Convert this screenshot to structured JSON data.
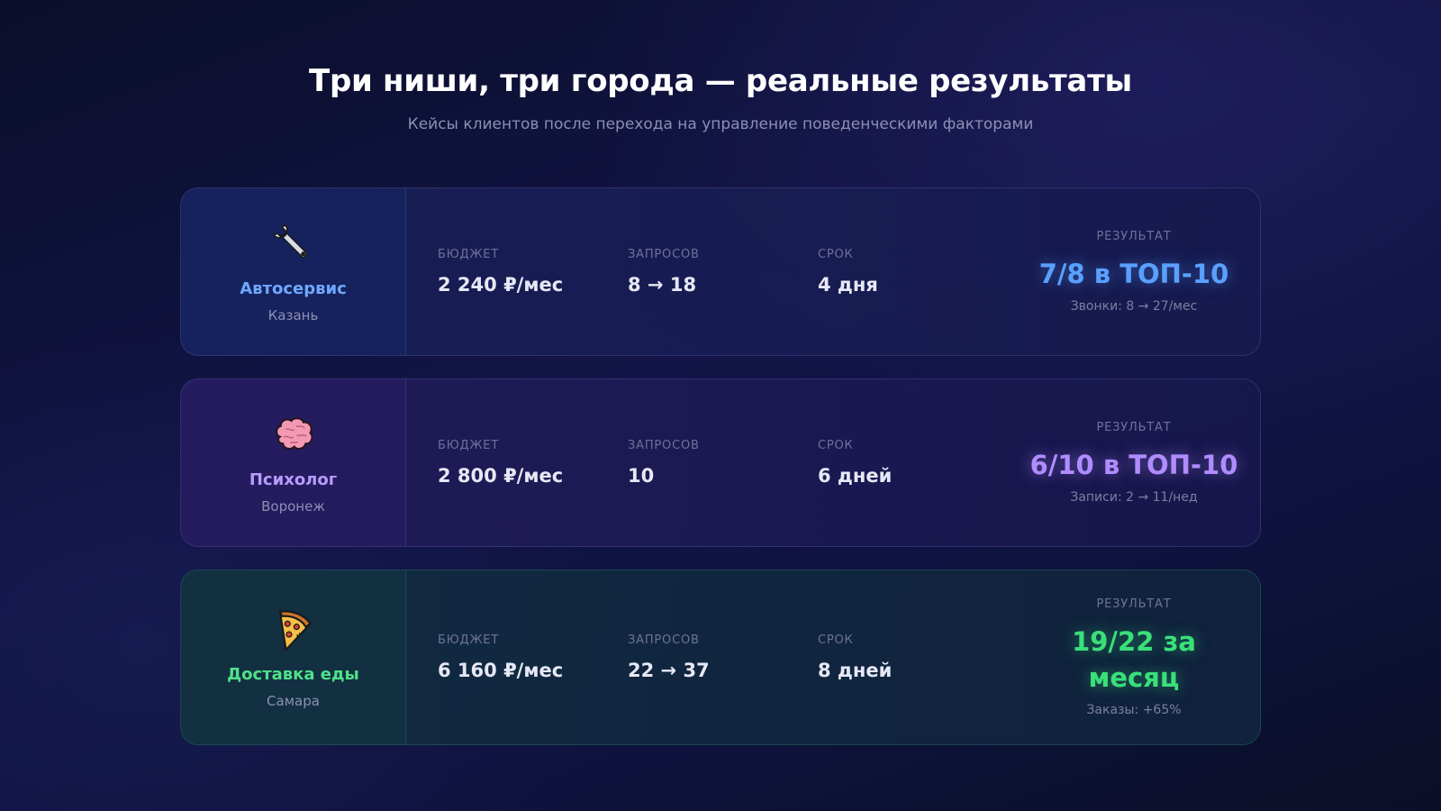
{
  "header": {
    "title": "Три ниши, три города — реальные результаты",
    "subtitle": "Кейсы клиентов после перехода на управление поведенческими факторами"
  },
  "labels": {
    "budget": "БЮДЖЕТ",
    "queries": "ЗАПРОСОВ",
    "term": "СРОК",
    "result": "РЕЗУЛЬТАТ"
  },
  "cases": [
    {
      "icon": "wrench-icon",
      "niche": "Автосервис",
      "city": "Казань",
      "budget": "2 240 ₽/мес",
      "queries": "8 → 18",
      "term": "4 дня",
      "result": "7/8 в ТОП-10",
      "note": "Звонки: 8 → 27/мес",
      "accent": "#5aa0ff"
    },
    {
      "icon": "brain-icon",
      "niche": "Психолог",
      "city": "Воронеж",
      "budget": "2 800 ₽/мес",
      "queries": "10",
      "term": "6 дней",
      "result": "6/10 в ТОП-10",
      "note": "Записи: 2 → 11/нед",
      "accent": "#b08cff"
    },
    {
      "icon": "pizza-icon",
      "niche": "Доставка еды",
      "city": "Самара",
      "budget": "6 160 ₽/мес",
      "queries": "22 → 37",
      "term": "8 дней",
      "result": "19/22 за месяц",
      "note": "Заказы: +65%",
      "accent": "#39e07a"
    }
  ]
}
